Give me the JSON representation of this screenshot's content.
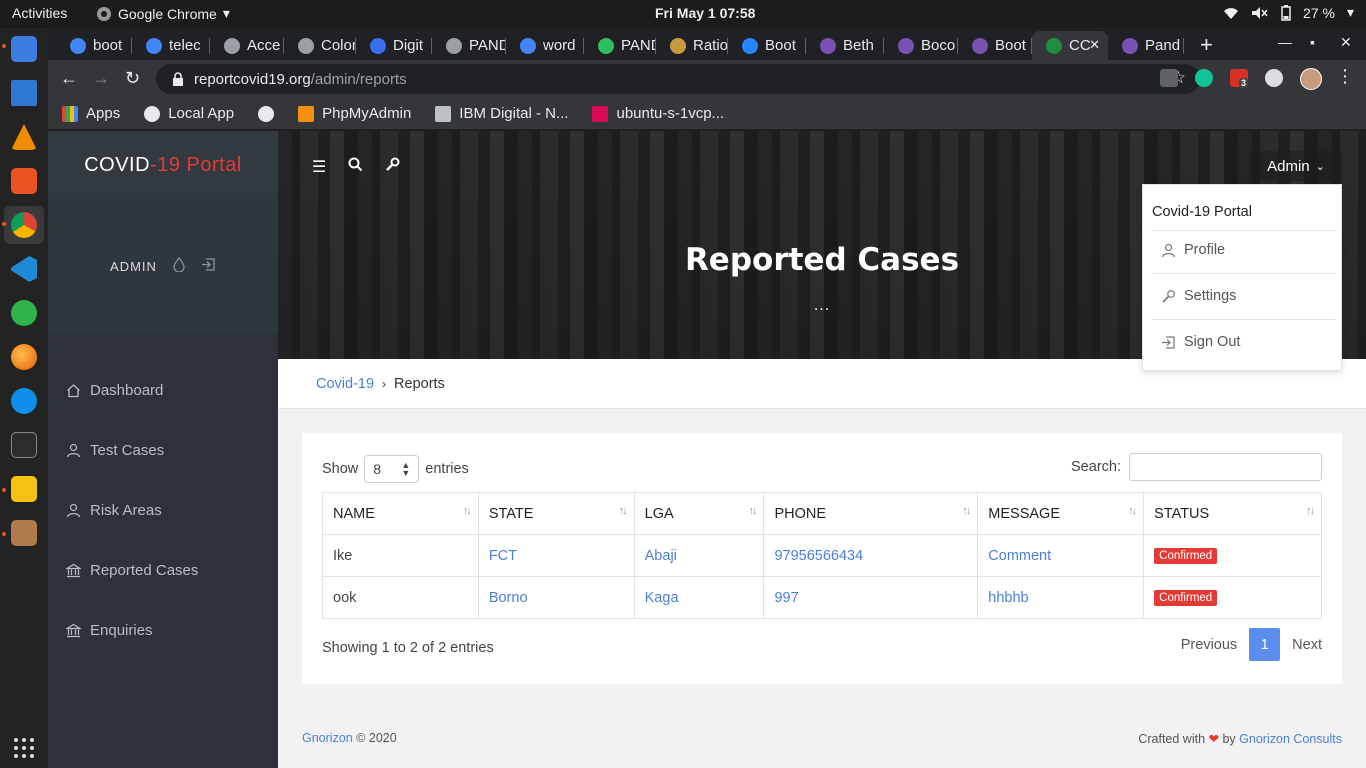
{
  "topbar": {
    "activities": "Activities",
    "app_name": "Google Chrome",
    "clock": "Fri May 1  07:58",
    "battery": "27 %"
  },
  "browser": {
    "tabs": [
      {
        "title": "boot",
        "favicon": "google-icon",
        "color": "#4285f4"
      },
      {
        "title": "telec",
        "favicon": "google-icon",
        "color": "#4285f4"
      },
      {
        "title": "Acce",
        "favicon": "wordpress-icon",
        "color": "#9aa0a6"
      },
      {
        "title": "Color",
        "favicon": "wordpress-icon",
        "color": "#9aa0a6"
      },
      {
        "title": "Digit",
        "favicon": "digitalocean-icon",
        "color": "#3b6df0"
      },
      {
        "title": "PAND",
        "favicon": "globe-icon",
        "color": "#9aa0a6"
      },
      {
        "title": "word",
        "favicon": "google-icon",
        "color": "#4285f4"
      },
      {
        "title": "PAND",
        "favicon": "evernote-icon",
        "color": "#2dbe60"
      },
      {
        "title": "Ratio",
        "favicon": "book-icon",
        "color": "#c69a3e"
      },
      {
        "title": "Boot",
        "favicon": "bitbucket-icon",
        "color": "#2684ff"
      },
      {
        "title": "Beth",
        "favicon": "bootstrap-icon",
        "color": "#7952b3"
      },
      {
        "title": "Boco",
        "favicon": "bootstrap-icon",
        "color": "#7952b3"
      },
      {
        "title": "Boot",
        "favicon": "bootstrap-icon",
        "color": "#7952b3"
      },
      {
        "title": "CC",
        "favicon": "sheet-icon",
        "color": "#1e8e3e"
      },
      {
        "title": "Pand",
        "favicon": "bootstrap-icon",
        "color": "#7952b3"
      }
    ],
    "active_tab_index": 13,
    "url_host": "reportcovid19.org",
    "url_path": "/admin/reports",
    "extension_badge": "3",
    "bookmarks": [
      {
        "label": "Apps",
        "icon": "apps-grid-icon"
      },
      {
        "label": "Local App",
        "icon": "globe-icon"
      },
      {
        "label": "",
        "icon": "globe-icon"
      },
      {
        "label": "PhpMyAdmin",
        "icon": "phpmyadmin-icon"
      },
      {
        "label": "IBM Digital - N...",
        "icon": "ibm-icon"
      },
      {
        "label": "ubuntu-s-1vcp...",
        "icon": "debian-icon"
      }
    ]
  },
  "app": {
    "brand_prefix": "COVID",
    "brand_suffix": "-19 Portal",
    "user_label": "ADMIN",
    "menu": [
      {
        "label": "Dashboard",
        "icon": "home-icon"
      },
      {
        "label": "Test Cases",
        "icon": "user-icon"
      },
      {
        "label": "Risk Areas",
        "icon": "user-icon"
      },
      {
        "label": "Reported Cases",
        "icon": "bank-icon"
      },
      {
        "label": "Enquiries",
        "icon": "bank-icon"
      }
    ],
    "admin_button": "Admin",
    "page_title": "Reported Cases",
    "page_title_dots": "...",
    "breadcrumb": {
      "root": "Covid-19",
      "current": "Reports"
    },
    "table": {
      "show_label": "Show",
      "entries_value": "8",
      "entries_label": "entries",
      "search_label": "Search:",
      "columns": [
        "NAME",
        "STATE",
        "LGA",
        "PHONE",
        "MESSAGE",
        "STATUS"
      ],
      "rows": [
        {
          "name": "Ike",
          "state": "FCT",
          "lga": "Abaji",
          "phone": "97956566434",
          "message": "Comment",
          "status": "Confirmed"
        },
        {
          "name": "ook",
          "state": "Borno",
          "lga": "Kaga",
          "phone": "997",
          "message": "hhbhb",
          "status": "Confirmed"
        }
      ],
      "info": "Showing 1 to 2 of 2 entries",
      "prev": "Previous",
      "page": "1",
      "next": "Next"
    },
    "dropdown": {
      "header": "Covid-19 Portal",
      "items": [
        {
          "label": "Profile",
          "icon": "user-icon"
        },
        {
          "label": "Settings",
          "icon": "wrench-icon"
        },
        {
          "label": "Sign Out",
          "icon": "sign-out-icon"
        }
      ]
    },
    "footer": {
      "company": "Gnorizon",
      "copy": "© 2020",
      "crafted": "Crafted with",
      "by": "by",
      "consults": "Gnorizon Consults"
    }
  },
  "colors": {
    "accent": "#4a7fd6",
    "danger": "#e53935",
    "sidebar": "#2c3238",
    "page_button": "#5b8def"
  }
}
